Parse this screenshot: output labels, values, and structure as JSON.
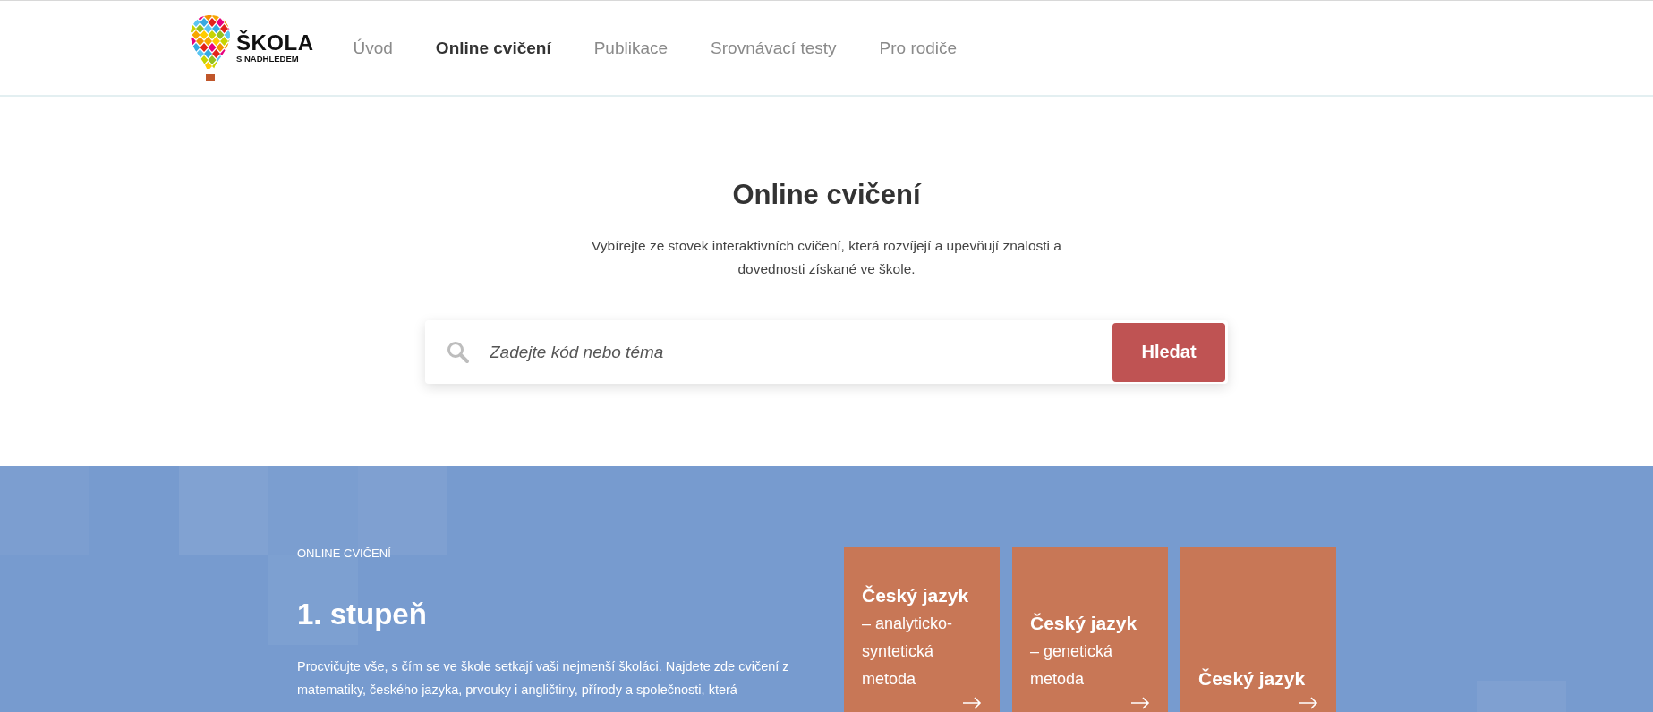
{
  "logo": {
    "title": "ŠKOLA",
    "subtitle": "S NADHLEDEM"
  },
  "nav": [
    {
      "label": "Úvod",
      "selected": false
    },
    {
      "label": "Online cvičení",
      "selected": true
    },
    {
      "label": "Publikace",
      "selected": false
    },
    {
      "label": "Srovnávací testy",
      "selected": false
    },
    {
      "label": "Pro rodiče",
      "selected": false
    }
  ],
  "hero": {
    "title": "Online cvičení",
    "subtitle": "Vybírejte ze stovek interaktivních cvičení, která rozvíjejí a upevňují znalosti a dovednosti získané ve škole."
  },
  "search": {
    "placeholder": "Zadejte kód nebo téma",
    "button": "Hledat"
  },
  "section": {
    "eyebrow": "ONLINE CVIČENÍ",
    "title": "1. stupeň",
    "text": "Procvičujte vše, s čím se ve škole setkají vaši nejmenší školáci. Najdete zde cvičení z matematiky, českého jazyka, prvouky i angličtiny, přírody a společnosti, která"
  },
  "cards": [
    {
      "title": "Český jazyk",
      "subtitle": "– analyticko-syntetická metoda"
    },
    {
      "title": "Český jazyk",
      "subtitle": "– genetická metoda"
    },
    {
      "title": "Český jazyk"
    }
  ]
}
